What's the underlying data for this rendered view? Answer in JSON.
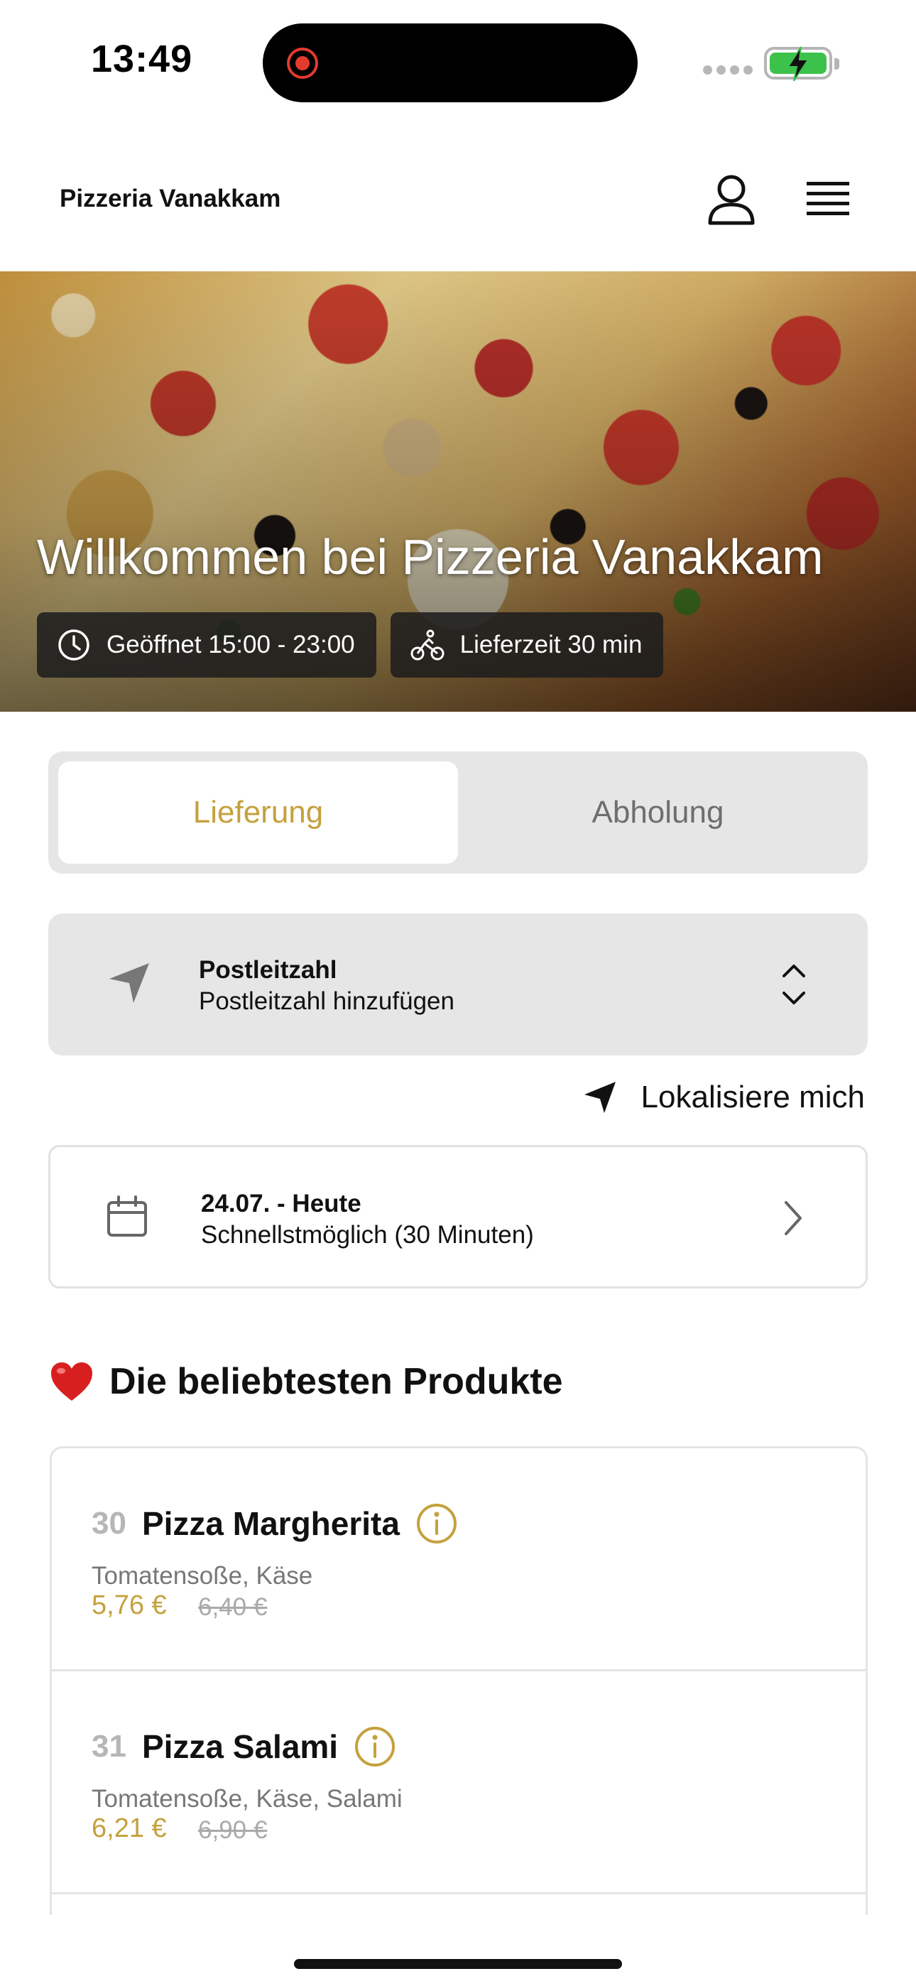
{
  "status_bar": {
    "time": "13:49",
    "battery_color": "#3cc14a",
    "recording_color": "#e23b2e"
  },
  "header": {
    "restaurant_name": "Pizzeria Vanakkam",
    "user_icon": "user-icon",
    "menu_icon": "hamburger-menu-icon"
  },
  "hero": {
    "title": "Willkommen bei Pizzeria Vanakkam",
    "opening_hours": "Geöffnet 15:00 - 23:00",
    "delivery_time": "Lieferzeit 30 min"
  },
  "order_mode": {
    "tabs": [
      "Lieferung",
      "Abholung"
    ],
    "selected": "Lieferung",
    "accent": "#c5a13d"
  },
  "postal_code": {
    "title": "Postleitzahl",
    "placeholder": "Postleitzahl hinzufügen"
  },
  "locate_me": {
    "label": "Lokalisiere mich"
  },
  "delivery_date": {
    "title": "24.07. - Heute",
    "subtitle": "Schnellstmöglich (30 Minuten)"
  },
  "popular": {
    "title": "Die beliebtesten Produkte",
    "emoji_icon": "heart-icon",
    "products": [
      {
        "number": "30",
        "name": "Pizza Margherita",
        "description": "Tomatensoße, Käse",
        "price": "5,76 €",
        "old_price": "6,40 €"
      },
      {
        "number": "31",
        "name": "Pizza Salami",
        "description": "Tomatensoße, Käse, Salami",
        "price": "6,21 €",
        "old_price": "6,90 €"
      }
    ]
  }
}
